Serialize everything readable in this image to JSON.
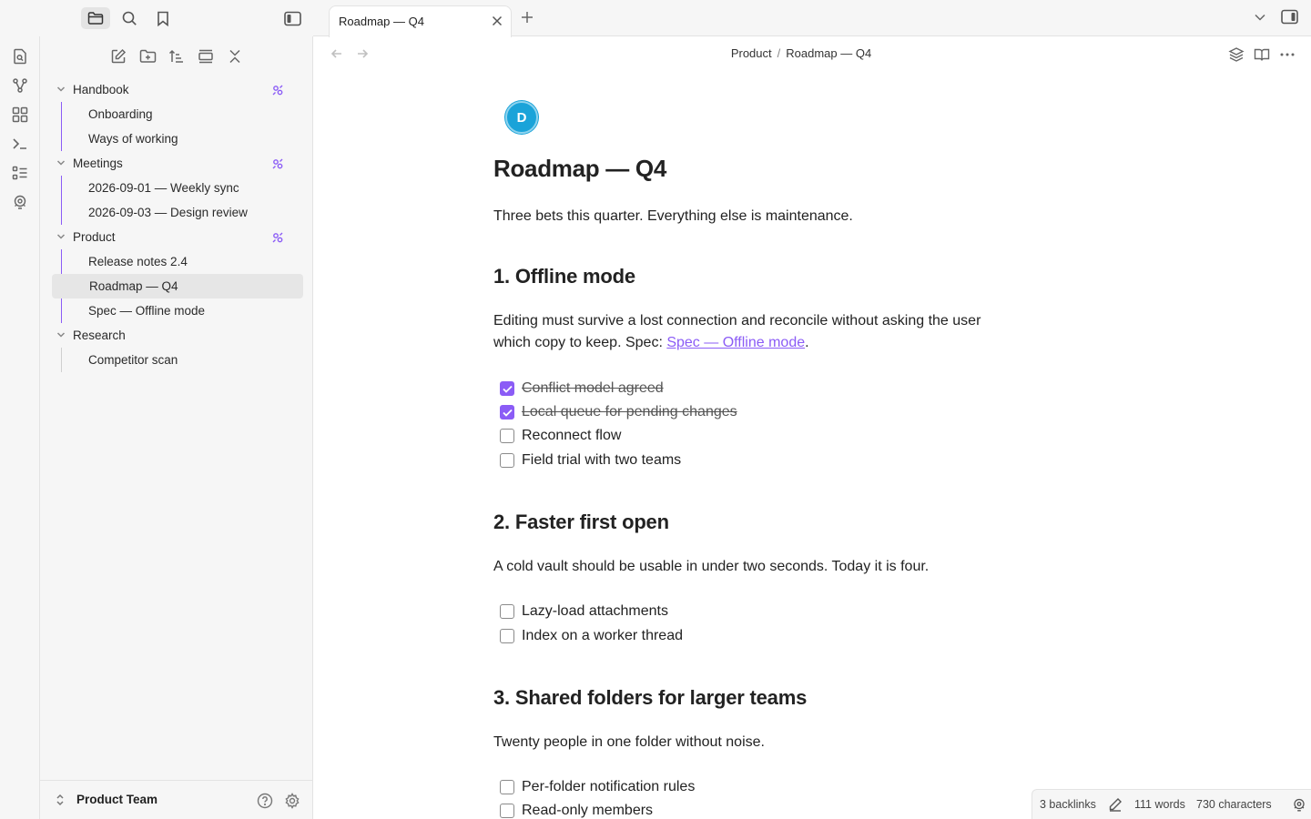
{
  "tab": {
    "title": "Roadmap — Q4"
  },
  "breadcrumb": {
    "parent": "Product",
    "separator": "/",
    "current": "Roadmap — Q4"
  },
  "tree": {
    "folders": [
      {
        "name": "Handbook",
        "files": [
          "Onboarding",
          "Ways of working"
        ]
      },
      {
        "name": "Meetings",
        "files": [
          "2026-09-01 — Weekly sync",
          "2026-09-03 — Design review"
        ]
      },
      {
        "name": "Product",
        "files": [
          "Release notes 2.4",
          "Roadmap — Q4",
          "Spec — Offline mode"
        ]
      },
      {
        "name": "Research",
        "files": [
          "Competitor scan"
        ]
      }
    ]
  },
  "vault": {
    "name": "Product Team"
  },
  "document": {
    "avatar_initial": "D",
    "title": "Roadmap — Q4",
    "intro": "Three bets this quarter. Everything else is maintenance.",
    "sections": [
      {
        "heading": "1. Offline mode",
        "body_line1": "Editing must survive a lost connection and reconcile without asking the user",
        "body_line2_prefix": "which copy to keep. Spec: ",
        "body_link": "Spec — Offline mode",
        "body_line2_suffix": ".",
        "tasks": [
          {
            "text": "Conflict model agreed",
            "done": true
          },
          {
            "text": "Local queue for pending changes",
            "done": true
          },
          {
            "text": "Reconnect flow",
            "done": false
          },
          {
            "text": "Field trial with two teams",
            "done": false
          }
        ]
      },
      {
        "heading": "2. Faster first open",
        "body": "A cold vault should be usable in under two seconds. Today it is four.",
        "tasks": [
          {
            "text": "Lazy-load attachments",
            "done": false
          },
          {
            "text": "Index on a worker thread",
            "done": false
          }
        ]
      },
      {
        "heading": "3. Shared folders for larger teams",
        "body": "Twenty people in one folder without noise.",
        "tasks": [
          {
            "text": "Per-folder notification rules",
            "done": false
          },
          {
            "text": "Read-only members",
            "done": false
          }
        ]
      }
    ]
  },
  "status": {
    "backlinks": "3 backlinks",
    "words": "111 words",
    "characters": "730 characters"
  },
  "colors": {
    "accent": "#8b5cf6",
    "avatar": "#1aa3d9",
    "sidebar_bg": "#f6f6f6"
  },
  "icons": {
    "ribbon": [
      "file-search-icon",
      "graph-icon",
      "canvas-icon",
      "terminal-icon",
      "list-icon",
      "plugin-icon"
    ],
    "sidebar_top": [
      "folder-icon",
      "search-icon",
      "bookmark-icon",
      "sidebar-toggle-icon"
    ],
    "sidebar_actions": [
      "new-note-icon",
      "new-folder-icon",
      "sort-icon",
      "auto-reveal-icon",
      "collapse-all-icon"
    ]
  }
}
